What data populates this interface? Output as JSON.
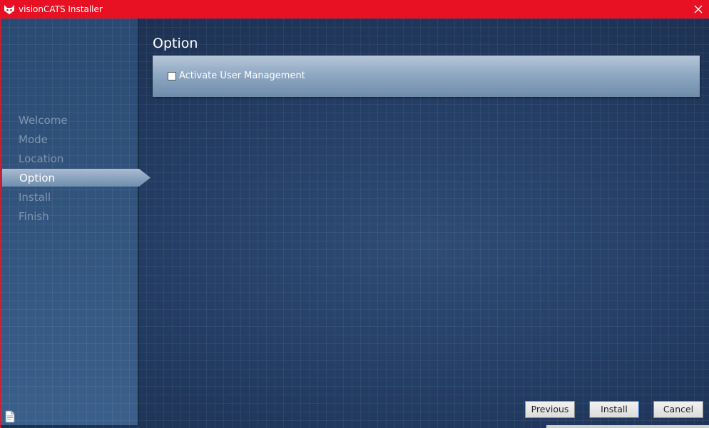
{
  "window": {
    "title": "visionCATS Installer"
  },
  "steps": [
    {
      "label": "Welcome"
    },
    {
      "label": "Mode"
    },
    {
      "label": "Location"
    },
    {
      "label": "Option"
    },
    {
      "label": "Install"
    },
    {
      "label": "Finish"
    }
  ],
  "active_step": "Option",
  "page": {
    "title": "Option",
    "checkbox_label": "Activate User Management",
    "checkbox_checked": false
  },
  "buttons": {
    "previous": "Previous",
    "install": "Install",
    "cancel": "Cancel"
  },
  "colors": {
    "titlebar": "#e81123",
    "background": "#1f3556",
    "sidebar": "#2f5078"
  },
  "icons": {
    "app": "cat-logo-icon",
    "close": "close-icon",
    "log": "document-icon"
  }
}
